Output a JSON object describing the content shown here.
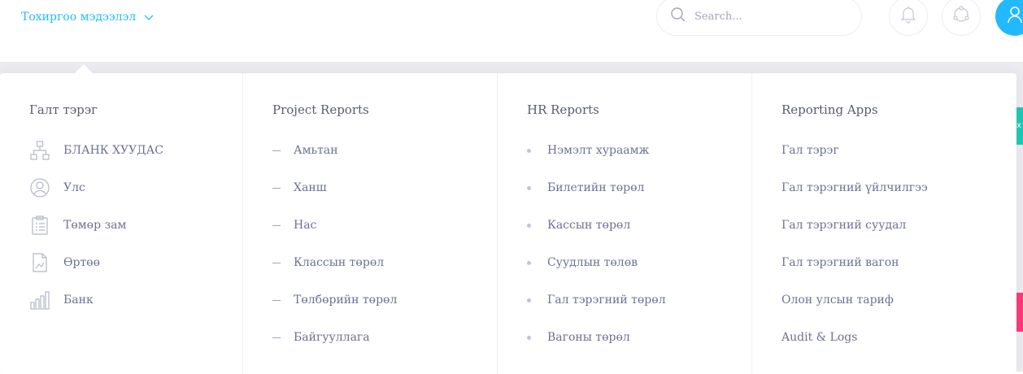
{
  "header": {
    "settings_label": "Тохиргоо мэдээлэл",
    "search_placeholder": "Search..."
  },
  "menu": {
    "columns": [
      {
        "heading": "Галт тэрэг",
        "style": "icon",
        "items": [
          {
            "label": "БЛАНК ХУУДАС",
            "icon": "sitemap-icon"
          },
          {
            "label": "Улс",
            "icon": "user-circle-icon"
          },
          {
            "label": "Төмөр зам",
            "icon": "clipboard-list-icon"
          },
          {
            "label": "Өртөө",
            "icon": "file-chart-icon"
          },
          {
            "label": "Банк",
            "icon": "bar-chart-icon"
          }
        ]
      },
      {
        "heading": "Project Reports",
        "style": "dash",
        "items": [
          {
            "label": "Амьтан"
          },
          {
            "label": "Ханш"
          },
          {
            "label": "Нас"
          },
          {
            "label": "Классын төрөл"
          },
          {
            "label": "Төлбөрийн төрөл"
          },
          {
            "label": "Байгууллага"
          }
        ]
      },
      {
        "heading": "HR Reports",
        "style": "dot",
        "items": [
          {
            "label": "Нэмэлт хураамж"
          },
          {
            "label": "Билетийн төрөл"
          },
          {
            "label": "Кассын төрөл"
          },
          {
            "label": "Суудлын төлөв"
          },
          {
            "label": "Гал тэрэгний төрөл"
          },
          {
            "label": "Вагоны төрөл"
          }
        ]
      },
      {
        "heading": "Reporting Apps",
        "style": "plain",
        "items": [
          {
            "label": "Гал тэрэг"
          },
          {
            "label": "Гал тэрэгний үйлчилгээ"
          },
          {
            "label": "Гал тэрэгний суудал"
          },
          {
            "label": "Гал тэрэгний вагон"
          },
          {
            "label": "Олон улсын тариф"
          },
          {
            "label": "Audit & Logs"
          }
        ]
      }
    ]
  },
  "colors": {
    "accent": "#22b9ff",
    "text": "#6c7293",
    "heading": "#595d6e"
  }
}
